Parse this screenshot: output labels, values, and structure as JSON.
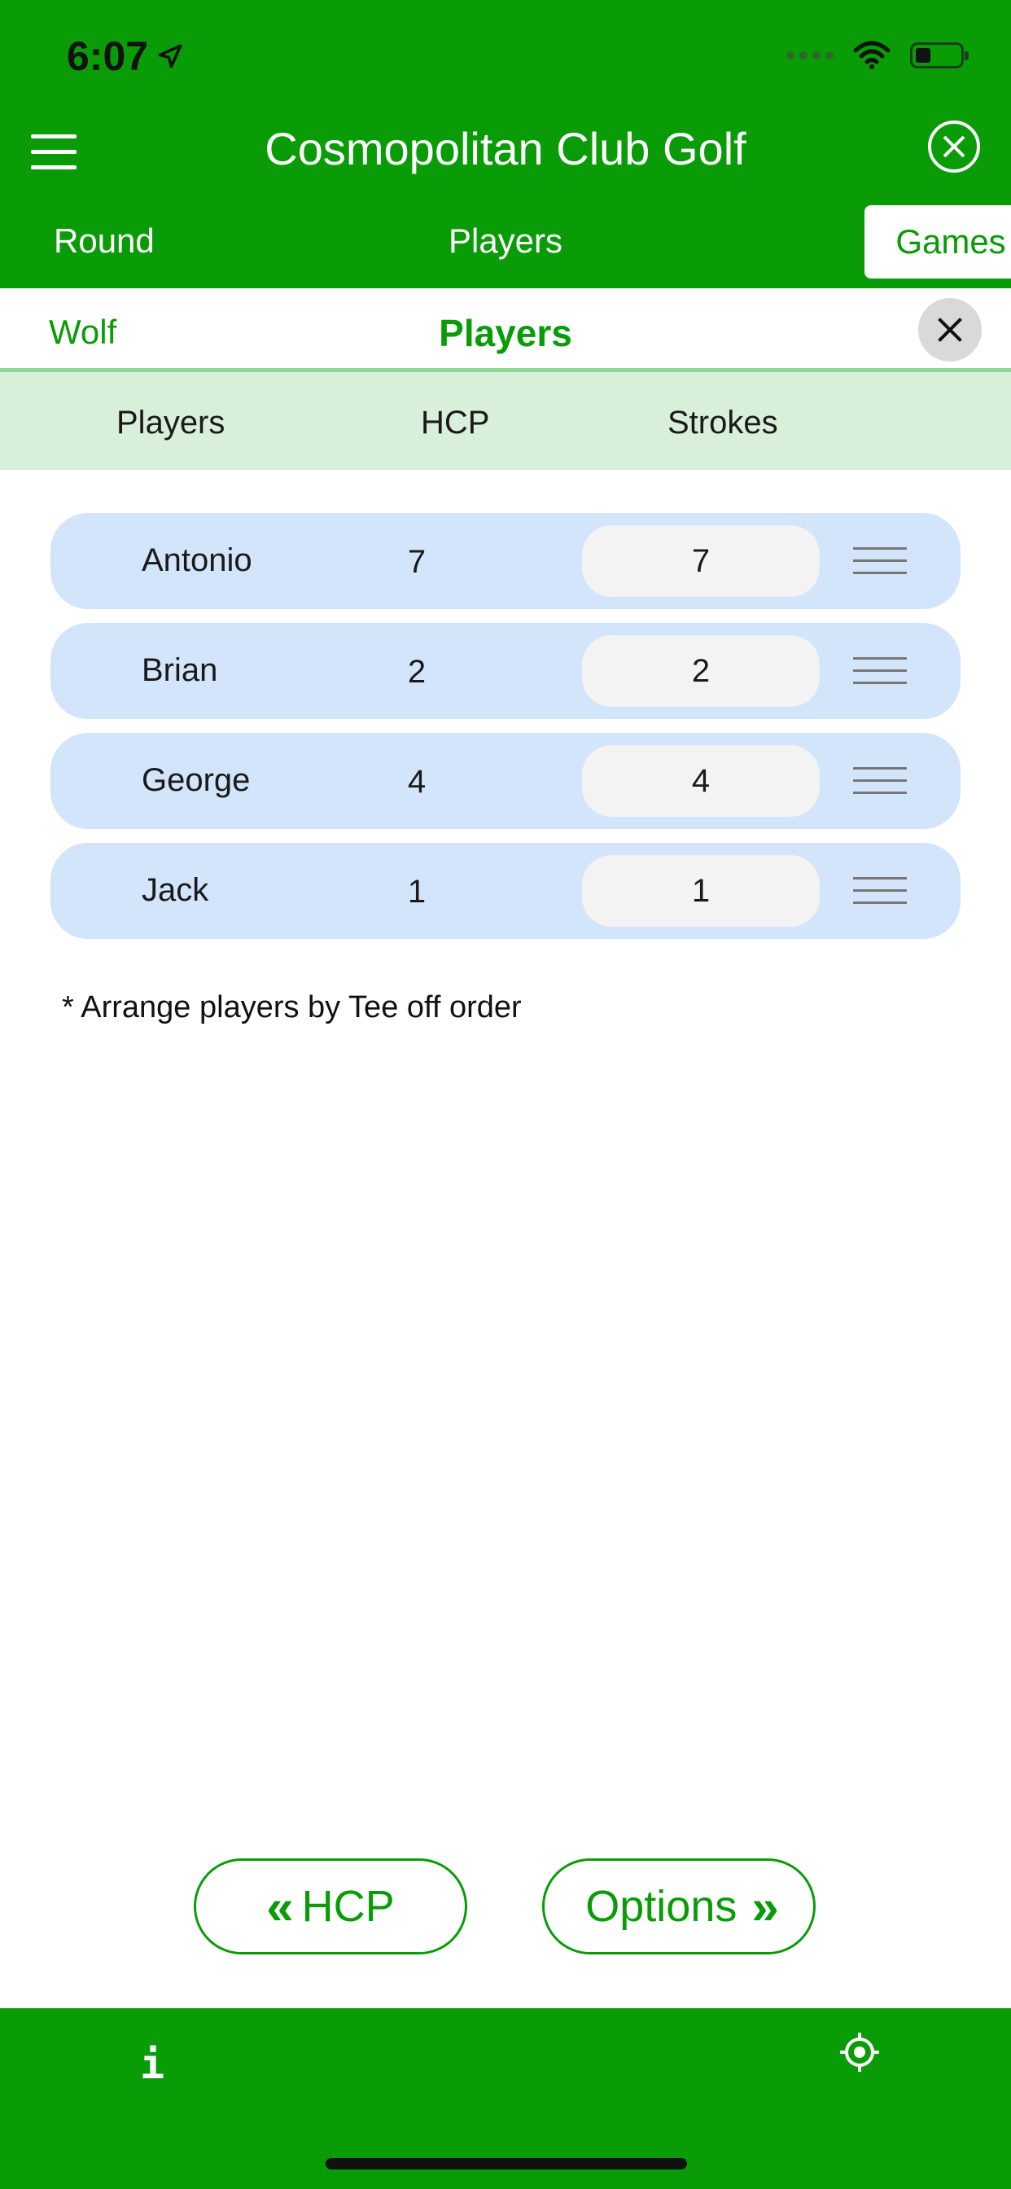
{
  "status_bar": {
    "time": "6:07"
  },
  "header": {
    "title": "Cosmopolitan Club Golf"
  },
  "tabs": {
    "round": "Round",
    "players": "Players",
    "games": "Games"
  },
  "sub_header": {
    "left": "Wolf",
    "title": "Players"
  },
  "columns": {
    "players": "Players",
    "hcp": "HCP",
    "strokes": "Strokes"
  },
  "players": [
    {
      "name": "Antonio",
      "hcp": "7",
      "strokes": "7"
    },
    {
      "name": "Brian",
      "hcp": "2",
      "strokes": "2"
    },
    {
      "name": "George",
      "hcp": "4",
      "strokes": "4"
    },
    {
      "name": "Jack",
      "hcp": "1",
      "strokes": "1"
    }
  ],
  "note": "* Arrange players by Tee off order",
  "buttons": {
    "back": "HCP",
    "next": "Options"
  },
  "bottom_bar": {
    "info": "i"
  },
  "colors": {
    "brand_green": "#099c07",
    "row_blue": "#d3e5fa",
    "header_light_green": "#d8efd9"
  }
}
